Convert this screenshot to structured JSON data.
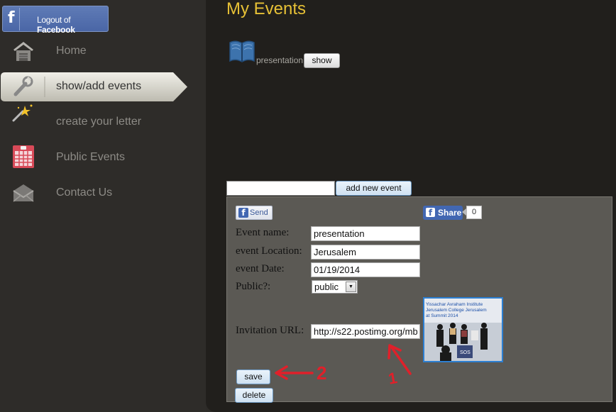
{
  "sidebar": {
    "logout": {
      "prefix": "Logout of ",
      "brand": "Facebook",
      "icon": "facebook-icon"
    },
    "items": [
      {
        "label": "Home",
        "icon": "home-icon",
        "active": false
      },
      {
        "label": "show/add events",
        "icon": "wrench-icon",
        "active": true
      },
      {
        "label": "create your letter",
        "icon": "magic-wand-icon",
        "active": false
      },
      {
        "label": "Public Events",
        "icon": "calendar-icon",
        "active": false
      },
      {
        "label": "Contact Us",
        "icon": "envelope-icon",
        "active": false
      }
    ]
  },
  "main": {
    "title": "My Events",
    "events": [
      {
        "name": "presentation",
        "icon": "book-icon",
        "show_label": "show"
      }
    ],
    "new_event": {
      "value": "",
      "button_label": "add new event"
    },
    "form": {
      "send_label": "Send",
      "share_label": "Share",
      "share_count": "0",
      "fields": {
        "name": {
          "label": "Event name:",
          "value": "presentation"
        },
        "location": {
          "label": "event Location:",
          "value": "Jerusalem"
        },
        "date": {
          "label": "event Date:",
          "value": "01/19/2014"
        },
        "public": {
          "label": "Public?:",
          "value": "public"
        },
        "invitation": {
          "label": "Invitation URL:",
          "value": "http://s22.postimg.org/mb"
        }
      },
      "image": {
        "caption_lines": [
          "Yissachar Avraham Institute",
          "Jerusalem College Jerusalem",
          "at Summit 2014"
        ],
        "banner": "SOS"
      },
      "save_label": "save",
      "delete_label": "delete"
    },
    "annotations": {
      "label_1": "1",
      "label_2": "2",
      "color": "#e0202a"
    }
  },
  "colors": {
    "title": "#e6c036",
    "facebook": "#4267b2",
    "panel": "#5b5954",
    "annotation": "#e0202a"
  }
}
